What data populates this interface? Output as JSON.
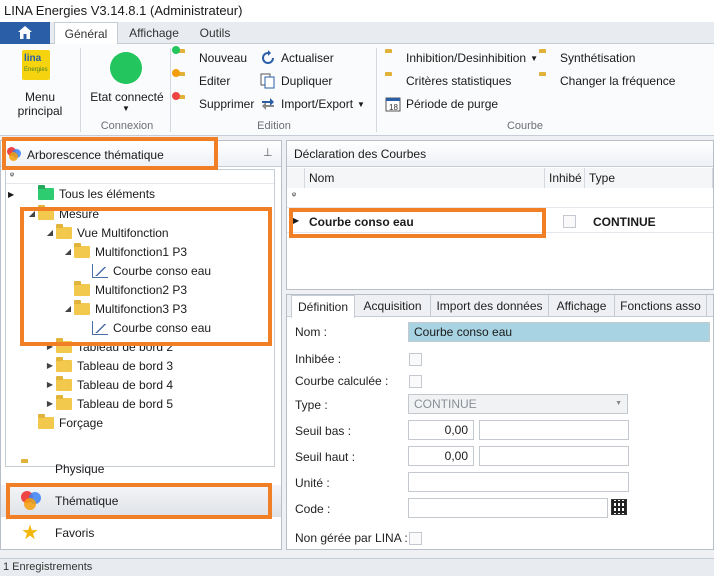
{
  "window": {
    "title": "LINA Energies  V3.14.8.1  (Administrateur)"
  },
  "ribbon_tabs": [
    {
      "label": "Général",
      "active": true
    },
    {
      "label": "Affichage",
      "active": false
    },
    {
      "label": "Outils",
      "active": false
    }
  ],
  "ribbon": {
    "menu_principal": "Menu principal",
    "logo_text": "lina",
    "logo_sub": "Energies",
    "etat_connecte": "Etat connecté",
    "connexion_label": "Connexion",
    "status_color": "#22c55e",
    "edition": {
      "label": "Edition",
      "nouveau": "Nouveau",
      "editer": "Editer",
      "supprimer": "Supprimer",
      "actualiser": "Actualiser",
      "dupliquer": "Dupliquer",
      "import_export": "Import/Export"
    },
    "courbe": {
      "label": "Courbe",
      "inhibition": "Inhibition/Desinhibition",
      "criteres": "Critères statistiques",
      "periode": "Période de purge",
      "synthetisation": "Synthétisation",
      "changer_freq": "Changer la fréquence"
    }
  },
  "left_panel": {
    "title": "Arborescence thématique",
    "tree": [
      {
        "label": "Tous les éléments"
      },
      {
        "label": "Mesure"
      },
      {
        "label": "Vue Multifonction"
      },
      {
        "label": "Multifonction1 P3"
      },
      {
        "label": "Courbe conso eau"
      },
      {
        "label": "Multifonction2 P3"
      },
      {
        "label": "Multifonction3 P3"
      },
      {
        "label": "Courbe conso eau"
      },
      {
        "label": "Tableau de bord 2"
      },
      {
        "label": "Tableau de bord 3"
      },
      {
        "label": "Tableau de bord 4"
      },
      {
        "label": "Tableau de bord 5"
      },
      {
        "label": "Forçage"
      }
    ],
    "nav": [
      {
        "label": "Physique"
      },
      {
        "label": "Thématique"
      },
      {
        "label": "Favoris"
      }
    ]
  },
  "declaration": {
    "title": "Déclaration des Courbes",
    "columns": {
      "nom": "Nom",
      "inhibe": "Inhibé",
      "type": "Type"
    },
    "rows": [
      {
        "nom": "Courbe conso eau",
        "type": "CONTINUE"
      }
    ]
  },
  "detail_tabs": [
    {
      "label": "Définition",
      "active": true
    },
    {
      "label": "Acquisition",
      "active": false
    },
    {
      "label": "Import des données",
      "active": false
    },
    {
      "label": "Affichage",
      "active": false
    },
    {
      "label": "Fonctions asso",
      "active": false
    }
  ],
  "form": {
    "nom_label": "Nom :",
    "nom_value": "Courbe conso eau",
    "inhibee_label": "Inhibée :",
    "calculee_label": "Courbe calculée :",
    "type_label": "Type :",
    "type_value": "CONTINUE",
    "seuil_bas_label": "Seuil bas :",
    "seuil_bas_value": "0,00",
    "seuil_haut_label": "Seuil haut :",
    "seuil_haut_value": "0,00",
    "unite_label": "Unité :",
    "code_label": "Code :",
    "non_geree_label": "Non gérée par LINA :"
  },
  "status": {
    "text": "1 Enregistrements"
  },
  "colors": {
    "accent": "#f07f25",
    "selected_field": "#a8d3e3",
    "brand_blue": "#2a5fa8"
  }
}
